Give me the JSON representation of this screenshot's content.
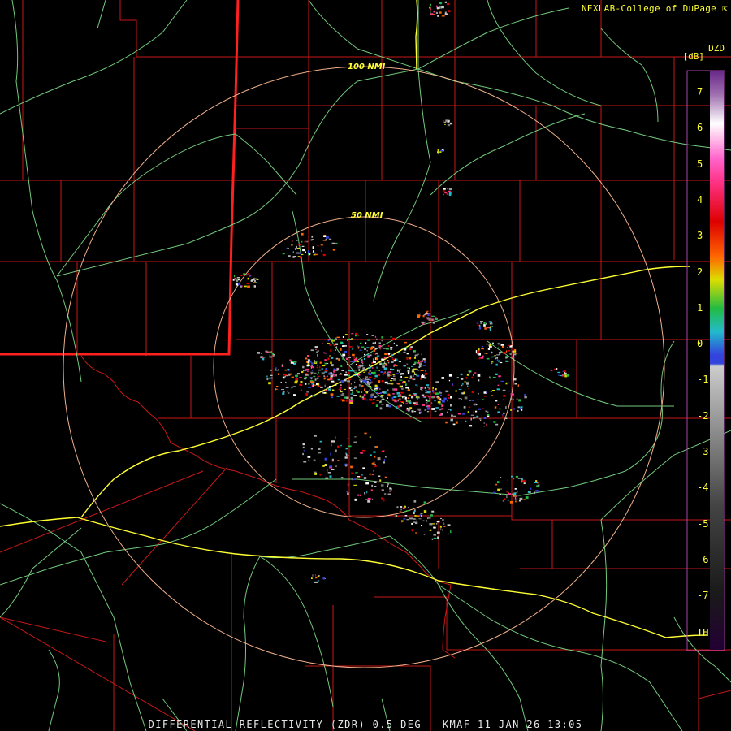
{
  "header": {
    "credit": "NEXLAB-College of DuPage",
    "product_code": "DZD",
    "unit": "[dB]"
  },
  "caption": "DIFFERENTIAL REFLECTIVITY (ZDR) 0.5 DEG - KMAF 11 JAN 26 13:05",
  "range_rings": [
    {
      "label": "100 NMI"
    },
    {
      "label": "50 NMI"
    }
  ],
  "colorbar": {
    "tick_labels": [
      "7",
      "6",
      "5",
      "4",
      "3",
      "2",
      "1",
      "0",
      "-1",
      "-2",
      "-3",
      "-4",
      "-5",
      "-6",
      "-7",
      "TH"
    ],
    "colors": {
      "top": "#6a2a8a",
      "white": "#ffffff",
      "magenta": "#ff33aa",
      "red": "#dd0000",
      "yellow": "#dddd00",
      "green": "#22bb44",
      "cyan": "#22bbcc",
      "blue": "#3344dd",
      "gray": "#aaaaaa",
      "dark": "#1a1a1a",
      "bottom": "#220033"
    }
  },
  "colors": {
    "county_lines": "#d02020",
    "state_line": "#ff2020",
    "highways": "#7fe08a",
    "interstates": "#ffff33",
    "rings": "#f0b08a"
  },
  "icons": [
    "external-link-icon"
  ]
}
